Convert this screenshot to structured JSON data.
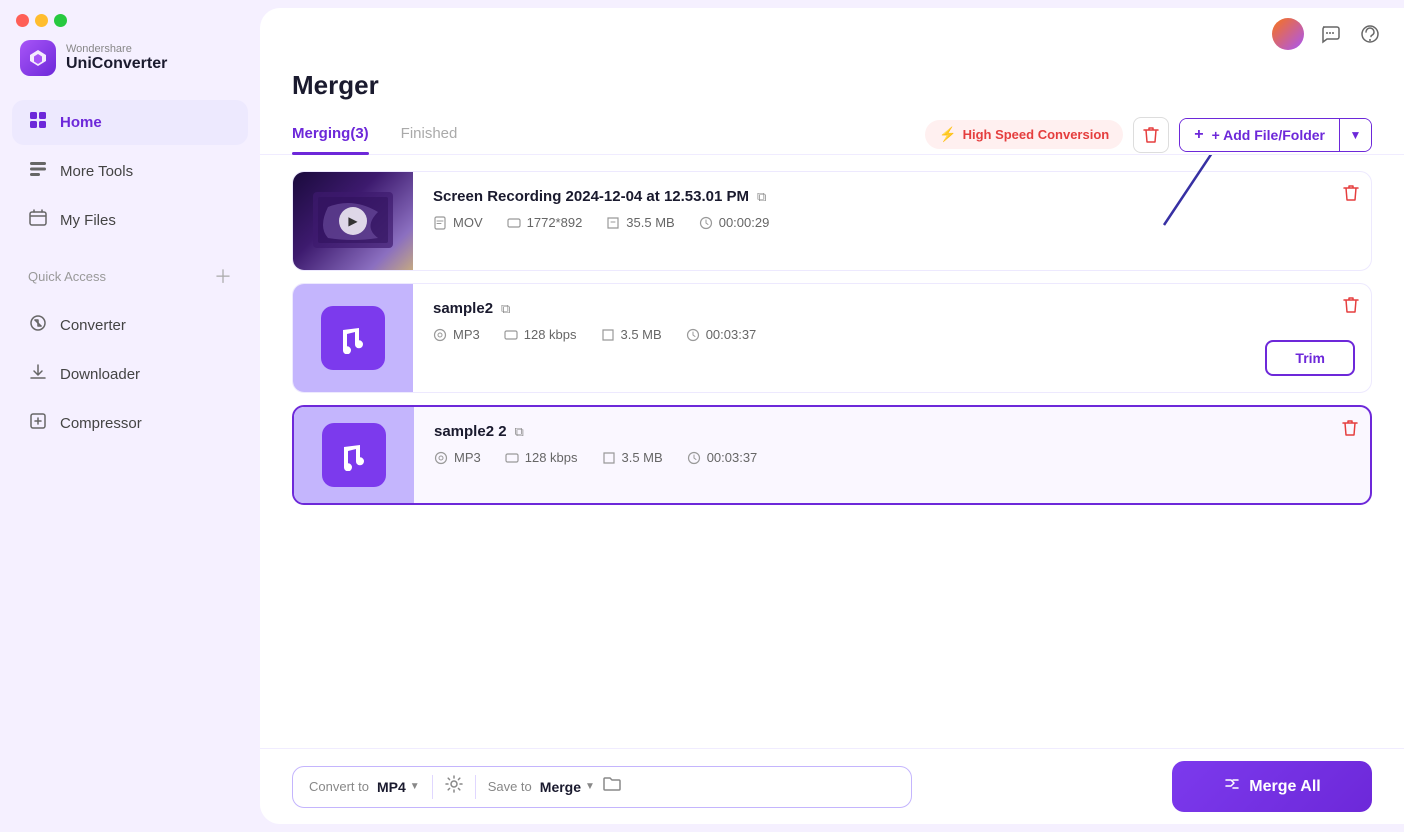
{
  "app": {
    "brand": "Wondershare",
    "name": "UniConverter",
    "window_title": "Merger"
  },
  "window_controls": {
    "close": "close",
    "minimize": "minimize",
    "maximize": "maximize"
  },
  "sidebar": {
    "nav_items": [
      {
        "id": "home",
        "label": "Home",
        "icon": "⌂",
        "active": true
      },
      {
        "id": "more-tools",
        "label": "More Tools",
        "icon": "⊞",
        "active": false
      },
      {
        "id": "my-files",
        "label": "My Files",
        "icon": "☰",
        "active": false
      }
    ],
    "quick_access_label": "Quick Access",
    "quick_access_items": [
      {
        "id": "converter",
        "label": "Converter",
        "icon": "↔"
      },
      {
        "id": "downloader",
        "label": "Downloader",
        "icon": "↓"
      },
      {
        "id": "compressor",
        "label": "Compressor",
        "icon": "◫"
      }
    ]
  },
  "topbar": {
    "avatar_alt": "User Avatar",
    "chat_icon": "💬",
    "headphones_icon": "🎧"
  },
  "page": {
    "title": "Merger",
    "tabs": [
      {
        "id": "merging",
        "label": "Merging(3)",
        "active": true
      },
      {
        "id": "finished",
        "label": "Finished",
        "active": false
      }
    ]
  },
  "toolbar": {
    "high_speed_label": "High Speed Conversion",
    "delete_tooltip": "Delete",
    "add_file_label": "+ Add File/Folder",
    "dropdown_arrow": "▼"
  },
  "files": [
    {
      "id": "file1",
      "name": "Screen Recording 2024-12-04 at 12.53.01 PM",
      "type": "video",
      "format": "MOV",
      "resolution": "1772*892",
      "size": "35.5 MB",
      "duration": "00:00:29",
      "selected": false,
      "has_trim": false
    },
    {
      "id": "file2",
      "name": "sample2",
      "type": "audio",
      "format": "MP3",
      "bitrate": "128 kbps",
      "size": "3.5 MB",
      "duration": "00:03:37",
      "selected": false,
      "has_trim": true,
      "trim_label": "Trim"
    },
    {
      "id": "file3",
      "name": "sample2 2",
      "type": "audio",
      "format": "MP3",
      "bitrate": "128 kbps",
      "size": "3.5 MB",
      "duration": "00:03:37",
      "selected": true,
      "has_trim": false
    }
  ],
  "bottom_bar": {
    "convert_to_label": "Convert to",
    "convert_format": "MP4",
    "save_to_label": "Save to",
    "save_location": "Merge",
    "merge_button_label": "Merge All"
  },
  "colors": {
    "accent": "#6d28d9",
    "accent_light": "#ede9fe",
    "danger": "#e53e3e",
    "brand_gradient_start": "#a855f7",
    "brand_gradient_end": "#6d28d9"
  }
}
